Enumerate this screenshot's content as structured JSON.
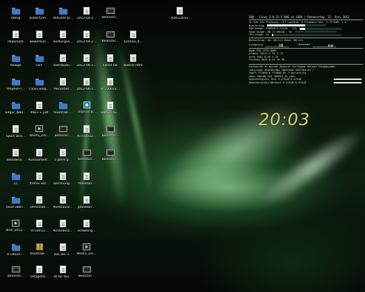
{
  "desktop": {
    "icons": [
      {
        "label": "Ablag",
        "type": "folder"
      },
      {
        "label": "bildschirm...",
        "type": "folder"
      },
      {
        "label": "Aktuelle Kl...",
        "type": "folder"
      },
      {
        "label": "2012-04-2...",
        "type": "doc"
      },
      {
        "label": "Bildschir...",
        "type": "image"
      },
      {
        "label": "RDS12031",
        "type": "doc"
      },
      {
        "label": "Paperkork",
        "type": "doc"
      },
      {
        "label": "Bewerbun...",
        "type": "doc"
      },
      {
        "label": "lesitungsa...",
        "type": "doc"
      },
      {
        "label": "2012-04-2...",
        "type": "doc"
      },
      {
        "label": "Bildschir...",
        "type": "image"
      },
      {
        "label": "120502_K...",
        "type": "doc"
      },
      {
        "label": "Ablage",
        "type": "folder"
      },
      {
        "label": "EBT",
        "type": "folder"
      },
      {
        "label": "distributio...",
        "type": "doc"
      },
      {
        "label": "2012-06-1...",
        "type": "doc"
      },
      {
        "label": "kaese.txt",
        "type": "doc"
      },
      {
        "label": "webscr.html",
        "type": "doc"
      },
      {
        "label": "stephen-l...",
        "type": "folder"
      },
      {
        "label": "Lilian_Blog...",
        "type": "folder"
      },
      {
        "label": "Herunterl...",
        "type": "doc"
      },
      {
        "label": "2012-06-1...",
        "type": "doc"
      },
      {
        "label": "ATT00031...",
        "type": "doc"
      },
      {
        "label": "Edgar_Wall...",
        "type": "folder"
      },
      {
        "label": "ifikk++.pdf",
        "type": "doc"
      },
      {
        "label": "teamtalk-...",
        "type": "folder"
      },
      {
        "label": "Thomas B...",
        "type": "script"
      },
      {
        "label": "Details zu...",
        "type": "doc"
      },
      {
        "label": "Sport Dire...",
        "type": "doc"
      },
      {
        "label": "WORS_Zei...",
        "type": "media"
      },
      {
        "label": "Bildschir...",
        "type": "image"
      },
      {
        "label": "ATT00032...",
        "type": "doc"
      },
      {
        "label": "Bildschir...",
        "type": "image"
      },
      {
        "label": "dwadwna...",
        "type": "doc"
      },
      {
        "label": "Auszuarbeit...",
        "type": "doc"
      },
      {
        "label": "5 Jahre p...",
        "type": "doc"
      },
      {
        "label": "bestatun...",
        "type": "image"
      },
      {
        "label": "Bildschir...",
        "type": "image"
      },
      {
        "label": "cc",
        "type": "folder"
      },
      {
        "label": "firefox aut...",
        "type": "doc"
      },
      {
        "label": "Rechnung...",
        "type": "doc"
      },
      {
        "label": "Planetarr...",
        "type": "doc"
      },
      {
        "label": "neue Uber...",
        "type": "folder"
      },
      {
        "label": "verschlan...",
        "type": "doc"
      },
      {
        "label": "Kontoausz...",
        "type": "doc"
      },
      {
        "label": "planetarr...",
        "type": "doc"
      },
      {
        "label": "dine_2012...",
        "type": "media"
      },
      {
        "label": "0730013...",
        "type": "doc"
      },
      {
        "label": "Kontoausz...",
        "type": "doc"
      },
      {
        "label": "schwierig...",
        "type": "doc"
      },
      {
        "label": "07360l3-...",
        "type": "folder"
      },
      {
        "label": "teamtalk-...",
        "type": "archive"
      },
      {
        "label": "aus der v...",
        "type": "doc"
      },
      {
        "label": "WORS_Zei...",
        "type": "media"
      },
      {
        "label": "Bildschir...",
        "type": "image"
      },
      {
        "label": "netzgefm...",
        "type": "doc"
      },
      {
        "label": "dt für tea...",
        "type": "doc"
      },
      {
        "label": "Bildschir...",
        "type": "image"
      }
    ]
  },
  "conky": {
    "header": "SVB - Linux 3.0.32-5-686 on i686 | Donnerstag, 21. Juni 2012",
    "uptime_line": "1h 52m 32s  Prozesse: 151  Laufend: 0  Frequenz GHz: 2.79 RAM: 1.4",
    "cpu_label": "Auslastung",
    "cpu_percent": 64,
    "ram_line": "RAM Usage: 490MiB/3.47GiB  -  13%",
    "ram_percent": 13,
    "swap_line": "Swap Usage: 0B  /1.98GiB  -  0%",
    "swap_percent": 0,
    "cpu_usage_line": "CPU Usage: 2%",
    "cpu_usage_percent": 2,
    "net_line": "Networking: Up: 0B  k/s    Down: 0B   k/s",
    "net_sub": "Eingehend",
    "net_sub2": "Gesendet",
    "proc_header": "Name          PID    CPU%   MEM%",
    "procs": [
      {
        "text": "pidgin         10213   2.35   1.75",
        "style": "hi"
      },
      {
        "text": "Xorg            1501   0.45   1.76",
        "style": "normal"
      },
      {
        "text": "firefox         2044   0.45  16.50",
        "style": "normal"
      }
    ],
    "disk_header": "Laufwerke             In Nutzen    Benutzt  Verfügbar  Belegt  Eingebunden",
    "disks": [
      "/dev/sda1      1045491904   10832320   5597964   6%  /",
      "tmpfs             772090          0     772090   0%  /lib/init/rw",
      "udev              766148        224     765924   1%  /dev"
    ],
    "ram_total_line": "Speicherplatz fest    5.27GiB  5.47GiB",
    "ram_swap_line": "Speicherplatz Wechsel  5.27GiB  5.47GiB",
    "clock": "20:03"
  }
}
